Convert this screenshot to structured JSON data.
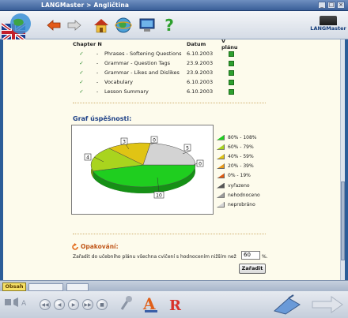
{
  "window": {
    "title": "LANGMaster > Angličtina",
    "controls": [
      "_",
      "□",
      "×"
    ]
  },
  "toolbar": {
    "brand": "LANGMaster",
    "icons": [
      "back-arrow-icon",
      "forward-arrow-icon",
      "home-icon",
      "globe-network-icon",
      "computer-icon",
      "help-question-icon"
    ],
    "help_glyph": "?"
  },
  "table": {
    "headers": {
      "chapter": "Chapter N",
      "datum": "Datum",
      "plan": "V plánu"
    },
    "rows": [
      {
        "check": "✓",
        "dash": "-",
        "name": "Phrases - Softening Questions",
        "date": "6.10.2003"
      },
      {
        "check": "✓",
        "dash": "-",
        "name": "Grammar - Question Tags",
        "date": "23.9.2003"
      },
      {
        "check": "✓",
        "dash": "-",
        "name": "Grammar - Likes and Dislikes",
        "date": "23.9.2003"
      },
      {
        "check": "✓",
        "dash": "-",
        "name": "Vocabulary",
        "date": "6.10.2003"
      },
      {
        "check": "✓",
        "dash": "-",
        "name": "Lesson Summary",
        "date": "6.10.2003"
      }
    ]
  },
  "graf": {
    "title": "Graf úspěšnosti:"
  },
  "chart_data": {
    "type": "pie",
    "title": "Graf úspěšnosti:",
    "slices": [
      {
        "label": "80% - 108%",
        "value": 10,
        "color": "#1fce1f"
      },
      {
        "label": "60% - 79%",
        "value": 4,
        "color": "#a9d41e"
      },
      {
        "label": "40% - 59%",
        "value": 3,
        "color": "#e0c414"
      },
      {
        "label": "20% - 39%",
        "value": 0,
        "color": "#e89a1a"
      },
      {
        "label": "0% - 19%",
        "value": 0,
        "color": "#e05a10"
      },
      {
        "label": "vyřazeno",
        "value": 0,
        "color": "#555555"
      },
      {
        "label": "nehodnoceno",
        "value": 0,
        "color": "#9a9a9a"
      },
      {
        "label": "neprobráno",
        "value": 5,
        "color": "#d3d3d3"
      }
    ],
    "data_labels": [
      "10",
      "4",
      "3",
      "0",
      "5",
      "0"
    ]
  },
  "opakovani": {
    "title": "Opakování:",
    "text": "Zařadit do učebního plánu všechna cvičení s hodnocením nižším než",
    "value": "60",
    "percent": "%.",
    "button": "Zařadit"
  },
  "tabs": {
    "obsah": "Obsah"
  }
}
